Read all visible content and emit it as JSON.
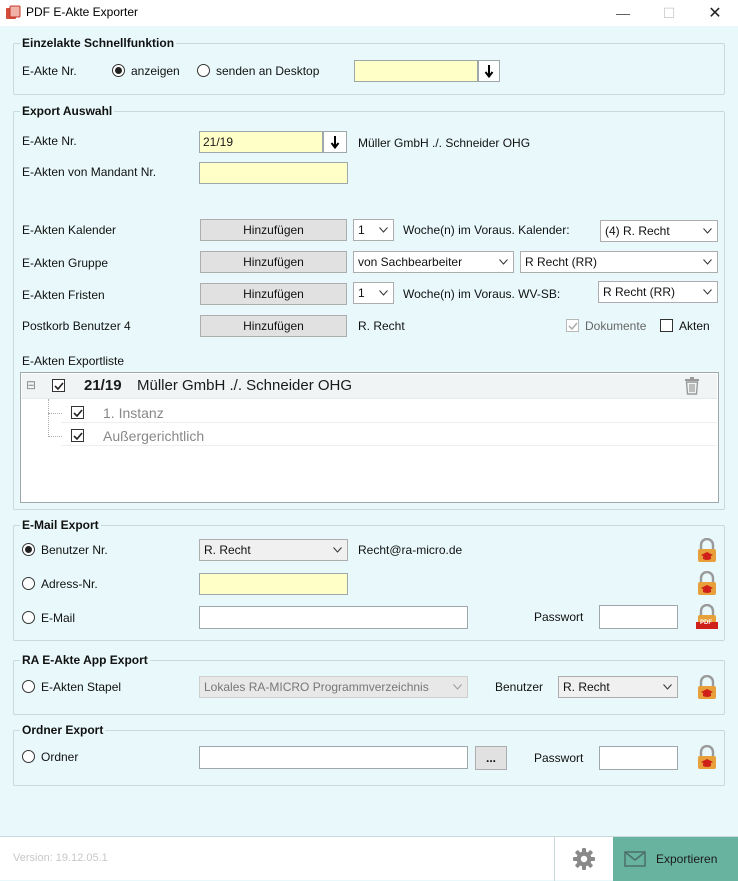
{
  "window": {
    "title": "PDF E-Akte Exporter",
    "minimize": "—",
    "maximize": "☐",
    "close": "✕"
  },
  "quick": {
    "title": "Einzelakte Schnellfunktion",
    "label": "E-Akte Nr.",
    "radio_show": "anzeigen",
    "radio_send": "senden an Desktop",
    "input_value": ""
  },
  "export": {
    "title": "Export Auswahl",
    "akte_label": "E-Akte Nr.",
    "akte_value": "21/19",
    "akte_name": "Müller GmbH ./. Schneider OHG",
    "mandant_label": "E-Akten von Mandant Nr.",
    "mandant_value": "",
    "kalender_label": "E-Akten Kalender",
    "add_label": "Hinzufügen",
    "weeks_value": "1",
    "kalender_text": "Woche(n) im Voraus. Kalender:",
    "kalender_select": "(4) R. Recht",
    "gruppe_label": "E-Akten Gruppe",
    "gruppe_select1": "von Sachbearbeiter",
    "gruppe_select2": "R Recht (RR)",
    "fristen_label": "E-Akten Fristen",
    "fristen_weeks": "1",
    "fristen_text": "Woche(n) im Voraus. WV-SB:",
    "fristen_select": "R Recht (RR)",
    "postkorb_label": "Postkorb Benutzer 4",
    "postkorb_user": "R. Recht",
    "dokumente_label": "Dokumente",
    "akten_label": "Akten",
    "list_label": "E-Akten Exportliste",
    "tree": {
      "root_nr": "21/19",
      "root_name": "Müller GmbH ./. Schneider OHG",
      "collapse": "⊟",
      "children": [
        "1. Instanz",
        "Außergerichtlich"
      ]
    }
  },
  "email": {
    "title": "E-Mail Export",
    "benutzer_label": "Benutzer Nr.",
    "benutzer_select": "R. Recht",
    "benutzer_email": "Recht@ra-micro.de",
    "adress_label": "Adress-Nr.",
    "adress_value": "",
    "email_label": "E-Mail",
    "email_value": "",
    "passwort_label": "Passwort",
    "passwort_value": "",
    "pdf_badge": "PDF"
  },
  "app": {
    "title": "RA E-Akte App Export",
    "stapel_label": "E-Akten Stapel",
    "stapel_select": "Lokales RA-MICRO Programmverzeichnis",
    "benutzer_label": "Benutzer",
    "benutzer_select": "R. Recht"
  },
  "ordner": {
    "title": "Ordner Export",
    "ordner_label": "Ordner",
    "ordner_value": "",
    "browse_label": "...",
    "passwort_label": "Passwort",
    "passwort_value": ""
  },
  "footer": {
    "version": "Version: 19.12.05.1",
    "export_label": "Exportieren"
  },
  "colors": {
    "background": "#e9f9fb",
    "yellow_field": "#ffffc8",
    "export_button": "#68b39f",
    "lock_red": "#d0201a",
    "lock_orange": "#e8a13a"
  }
}
